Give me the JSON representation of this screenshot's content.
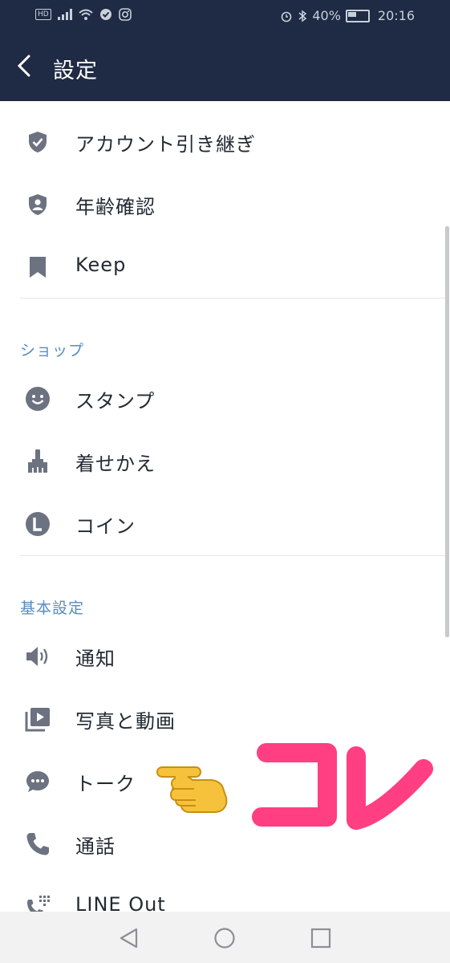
{
  "status_bar": {
    "left_icons": [
      "hd-icon",
      "signal-icon",
      "wifi-icon",
      "check-icon",
      "instagram-icon"
    ],
    "battery_percent": "40%",
    "time": "20:16"
  },
  "header": {
    "title": "設定",
    "back_icon": "chevron-left-icon"
  },
  "groups": [
    {
      "title": "",
      "items": [
        {
          "label": "アカウント引き継ぎ",
          "icon": "shield-check-icon"
        },
        {
          "label": "年齢確認",
          "icon": "shield-person-icon"
        },
        {
          "label": "Keep",
          "icon": "bookmark-icon"
        }
      ]
    },
    {
      "title": "ショップ",
      "items": [
        {
          "label": "スタンプ",
          "icon": "smiley-icon"
        },
        {
          "label": "着せかえ",
          "icon": "paintbrush-icon"
        },
        {
          "label": "コイン",
          "icon": "coin-l-icon"
        }
      ]
    },
    {
      "title": "基本設定",
      "items": [
        {
          "label": "通知",
          "icon": "speaker-icon"
        },
        {
          "label": "写真と動画",
          "icon": "media-icon"
        },
        {
          "label": "トーク",
          "icon": "chat-bubble-icon"
        },
        {
          "label": "通話",
          "icon": "phone-icon"
        },
        {
          "label": "LINE Out",
          "icon": "phone-dialpad-icon"
        }
      ]
    }
  ],
  "annotation": {
    "text": "コレ",
    "color": "#ff3f82",
    "pointer": "pointing-hand-icon"
  },
  "nav_bar": [
    "back-triangle-icon",
    "home-circle-icon",
    "recents-square-icon"
  ]
}
